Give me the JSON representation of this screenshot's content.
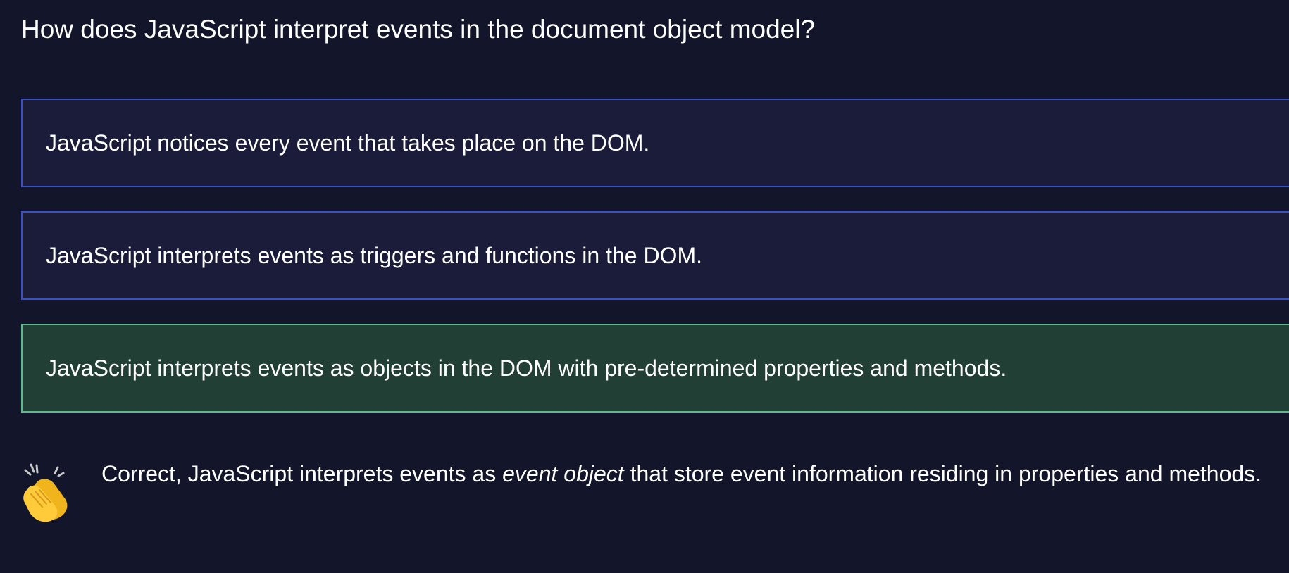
{
  "question": {
    "text": "How does JavaScript interpret events in the document object model?"
  },
  "options": [
    {
      "label": "JavaScript notices every event that takes place on the DOM.",
      "state": "default"
    },
    {
      "label": "JavaScript interprets events as triggers and functions in the DOM.",
      "state": "default"
    },
    {
      "label": "JavaScript interprets events as objects in the DOM with pre-determined properties and methods.",
      "state": "correct"
    }
  ],
  "feedback": {
    "icon": "clapping-hands-icon",
    "text_before": "Correct, JavaScript interprets events as ",
    "emphasis": "event object",
    "text_after": " that store event information residing in properties and methods."
  },
  "colors": {
    "background": "#13152b",
    "option_border": "#3b50c2",
    "option_background": "#1a1c3a",
    "correct_border": "#5dba8a",
    "correct_background": "#223f35"
  }
}
